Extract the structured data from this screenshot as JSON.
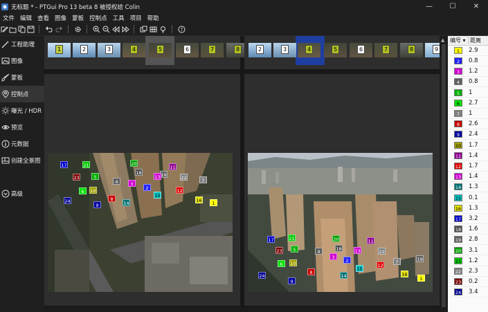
{
  "window": {
    "title": "无标题 * - PTGui Pro 13 beta 8 被授权给 Colin",
    "minimize": "—",
    "maximize": "☐",
    "close": "✕"
  },
  "menu": [
    "文件",
    "编辑",
    "查看",
    "图像",
    "蒙板",
    "控制点",
    "工具",
    "项目",
    "帮助"
  ],
  "sidebar": {
    "items": [
      {
        "label": "工程助理",
        "icon": "wand-icon"
      },
      {
        "label": "图像",
        "icon": "image-icon"
      },
      {
        "label": "蒙板",
        "icon": "brush-icon"
      },
      {
        "label": "控制点",
        "icon": "control-point-icon"
      },
      {
        "label": "曝光 / HDR",
        "icon": "sun-icon"
      },
      {
        "label": "预览",
        "icon": "eye-icon"
      },
      {
        "label": "元数据",
        "icon": "info-icon"
      },
      {
        "label": "创建全景图",
        "icon": "panorama-icon"
      },
      {
        "label": "高级",
        "icon": "chevron-down-icon"
      }
    ],
    "active_index": 3
  },
  "left_strip": {
    "thumbs": [
      "1",
      "2",
      "3",
      "4",
      "5",
      "6",
      "7",
      "8"
    ],
    "selected": "5"
  },
  "right_strip": {
    "thumbs": [
      "2",
      "3",
      "4",
      "5",
      "6",
      "7",
      "8",
      "9"
    ],
    "selected": "4"
  },
  "left_image_points": [
    {
      "id": "17",
      "color": "#0000c8",
      "text": "#ffffff"
    },
    {
      "id": "21",
      "color": "#00c800",
      "text": "#ffffff"
    },
    {
      "id": "23",
      "color": "#7a0000",
      "text": "#ffffff"
    },
    {
      "id": "5",
      "color": "#00b000",
      "text": "#ffffff"
    },
    {
      "id": "10",
      "color": "#a0a000",
      "text": "#ffffff"
    },
    {
      "id": "6",
      "color": "#00e000",
      "text": "#ffffff"
    },
    {
      "id": "8",
      "color": "#c80000",
      "text": "#ffffff"
    },
    {
      "id": "9",
      "color": "#0000a0",
      "text": "#ffffff"
    },
    {
      "id": "24",
      "color": "#000090",
      "text": "#ffffff"
    },
    {
      "id": "20",
      "color": "#00a000",
      "text": "#ffffff"
    },
    {
      "id": "18",
      "color": "#505050",
      "text": "#ffffff"
    },
    {
      "id": "4",
      "color": "#606060",
      "text": "#ffffff"
    },
    {
      "id": "3",
      "color": "#d000d0",
      "text": "#ffffff"
    },
    {
      "id": "19",
      "color": "#606060",
      "text": "#ffffff"
    },
    {
      "id": "2",
      "color": "#2020ff",
      "text": "#ffffff"
    },
    {
      "id": "14",
      "color": "#007070",
      "text": "#ffffff"
    },
    {
      "id": "11",
      "color": "#900090",
      "text": "#ffffff"
    },
    {
      "id": "13",
      "color": "#d000d0",
      "text": "#ffffff"
    },
    {
      "id": "15",
      "color": "#00c0c0",
      "text": "#000000"
    },
    {
      "id": "22",
      "color": "#808080",
      "text": "#ffffff"
    },
    {
      "id": "12",
      "color": "#e00000",
      "text": "#ffffff"
    },
    {
      "id": "7",
      "color": "#808080",
      "text": "#ffffff"
    },
    {
      "id": "16",
      "color": "#e0e000",
      "text": "#000000"
    },
    {
      "id": "1",
      "color": "#ffff00",
      "text": "#000000"
    }
  ],
  "right_image_points": [
    {
      "id": "17",
      "color": "#0000c8",
      "text": "#ffffff"
    },
    {
      "id": "21",
      "color": "#00c800",
      "text": "#ffffff"
    },
    {
      "id": "5",
      "color": "#00b000",
      "text": "#ffffff"
    },
    {
      "id": "23",
      "color": "#7a0000",
      "text": "#ffffff"
    },
    {
      "id": "6",
      "color": "#00e000",
      "text": "#ffffff"
    },
    {
      "id": "10",
      "color": "#a0a000",
      "text": "#ffffff"
    },
    {
      "id": "24",
      "color": "#000090",
      "text": "#ffffff"
    },
    {
      "id": "9",
      "color": "#0000a0",
      "text": "#ffffff"
    },
    {
      "id": "8",
      "color": "#c80000",
      "text": "#ffffff"
    },
    {
      "id": "4",
      "color": "#606060",
      "text": "#ffffff"
    },
    {
      "id": "20",
      "color": "#00a000",
      "text": "#ffffff"
    },
    {
      "id": "18",
      "color": "#505050",
      "text": "#ffffff"
    },
    {
      "id": "3",
      "color": "#d000d0",
      "text": "#ffffff"
    },
    {
      "id": "2",
      "color": "#2020ff",
      "text": "#ffffff"
    },
    {
      "id": "13",
      "color": "#d000d0",
      "text": "#ffffff"
    },
    {
      "id": "11",
      "color": "#900090",
      "text": "#ffffff"
    },
    {
      "id": "15",
      "color": "#00c0c0",
      "text": "#000000"
    },
    {
      "id": "14",
      "color": "#007070",
      "text": "#ffffff"
    },
    {
      "id": "12",
      "color": "#e00000",
      "text": "#ffffff"
    },
    {
      "id": "22",
      "color": "#808080",
      "text": "#ffffff"
    },
    {
      "id": "19",
      "color": "#606060",
      "text": "#ffffff"
    },
    {
      "id": "7",
      "color": "#808080",
      "text": "#ffffff"
    },
    {
      "id": "16",
      "color": "#e0e000",
      "text": "#000000"
    },
    {
      "id": "1",
      "color": "#ffff00",
      "text": "#000000"
    }
  ],
  "table": {
    "col_id": "编号 ▾",
    "col_dist": "距离",
    "rows": [
      {
        "id": "1",
        "color": "#ffff00",
        "text": "#000000",
        "dist": "2.9"
      },
      {
        "id": "2",
        "color": "#2020ff",
        "text": "#ffffff",
        "dist": "0.8"
      },
      {
        "id": "3",
        "color": "#d000d0",
        "text": "#ffffff",
        "dist": "1.2"
      },
      {
        "id": "4",
        "color": "#606060",
        "text": "#ffffff",
        "dist": "0.8"
      },
      {
        "id": "5",
        "color": "#00b000",
        "text": "#ffffff",
        "dist": "1"
      },
      {
        "id": "6",
        "color": "#00e000",
        "text": "#000000",
        "dist": "2.7"
      },
      {
        "id": "7",
        "color": "#808080",
        "text": "#ffffff",
        "dist": "1"
      },
      {
        "id": "8",
        "color": "#c80000",
        "text": "#ffffff",
        "dist": "2.6"
      },
      {
        "id": "9",
        "color": "#0000a0",
        "text": "#ffffff",
        "dist": "2.4"
      },
      {
        "id": "10",
        "color": "#a0a000",
        "text": "#000000",
        "dist": "1.7"
      },
      {
        "id": "11",
        "color": "#900090",
        "text": "#ffffff",
        "dist": "1.4"
      },
      {
        "id": "12",
        "color": "#e00000",
        "text": "#ffffff",
        "dist": "1.7"
      },
      {
        "id": "13",
        "color": "#d000d0",
        "text": "#ffffff",
        "dist": "1.4"
      },
      {
        "id": "14",
        "color": "#007070",
        "text": "#ffffff",
        "dist": "1.3"
      },
      {
        "id": "15",
        "color": "#00c0c0",
        "text": "#000000",
        "dist": "0.1"
      },
      {
        "id": "16",
        "color": "#e0e000",
        "text": "#000000",
        "dist": "1.3"
      },
      {
        "id": "17",
        "color": "#0000c8",
        "text": "#ffffff",
        "dist": "3.2"
      },
      {
        "id": "18",
        "color": "#505050",
        "text": "#ffffff",
        "dist": "1.6"
      },
      {
        "id": "19",
        "color": "#606060",
        "text": "#ffffff",
        "dist": "2.8"
      },
      {
        "id": "20",
        "color": "#00a000",
        "text": "#ffffff",
        "dist": "3.1"
      },
      {
        "id": "21",
        "color": "#00c800",
        "text": "#000000",
        "dist": "1.2"
      },
      {
        "id": "22",
        "color": "#808080",
        "text": "#ffffff",
        "dist": "2.3"
      },
      {
        "id": "23",
        "color": "#7a0000",
        "text": "#ffffff",
        "dist": "0.2"
      },
      {
        "id": "24",
        "color": "#000090",
        "text": "#ffffff",
        "dist": "3.4"
      }
    ]
  },
  "colors": {
    "accent_selected_left": "#555555",
    "accent_selected_right": "#1e3fa0"
  }
}
